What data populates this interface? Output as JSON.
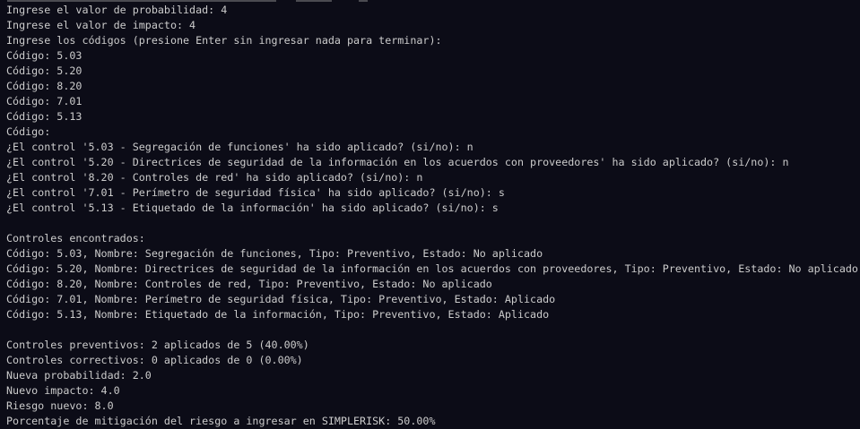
{
  "terminal": {
    "lines": [
      "Ingrese el valor de probabilidad: 4",
      "Ingrese el valor de impacto: 4",
      "Ingrese los códigos (presione Enter sin ingresar nada para terminar):",
      "Código: 5.03",
      "Código: 5.20",
      "Código: 8.20",
      "Código: 7.01",
      "Código: 5.13",
      "Código:",
      "¿El control '5.03 - Segregación de funciones' ha sido aplicado? (si/no): n",
      "¿El control '5.20 - Directrices de seguridad de la información en los acuerdos con proveedores' ha sido aplicado? (si/no): n",
      "¿El control '8.20 - Controles de red' ha sido aplicado? (si/no): n",
      "¿El control '7.01 - Perímetro de seguridad física' ha sido aplicado? (si/no): s",
      "¿El control '5.13 - Etiquetado de la información' ha sido aplicado? (si/no): s",
      "",
      "Controles encontrados:",
      "Código: 5.03, Nombre: Segregación de funciones, Tipo: Preventivo, Estado: No aplicado",
      "Código: 5.20, Nombre: Directrices de seguridad de la información en los acuerdos con proveedores, Tipo: Preventivo, Estado: No aplicado",
      "Código: 8.20, Nombre: Controles de red, Tipo: Preventivo, Estado: No aplicado",
      "Código: 7.01, Nombre: Perímetro de seguridad física, Tipo: Preventivo, Estado: Aplicado",
      "Código: 5.13, Nombre: Etiquetado de la información, Tipo: Preventivo, Estado: Aplicado",
      "",
      "Controles preventivos: 2 aplicados de 5 (40.00%)",
      "Controles correctivos: 0 aplicados de 0 (0.00%)",
      "Nueva probabilidad: 2.0",
      "Nuevo impacto: 4.0",
      "Riesgo nuevo: 8.0",
      "Porcentaje de mitigación del riesgo a ingresar en SIMPLERISK: 50.00%"
    ]
  },
  "colors": {
    "background": "#0c0c17",
    "text": "#cccccc"
  }
}
